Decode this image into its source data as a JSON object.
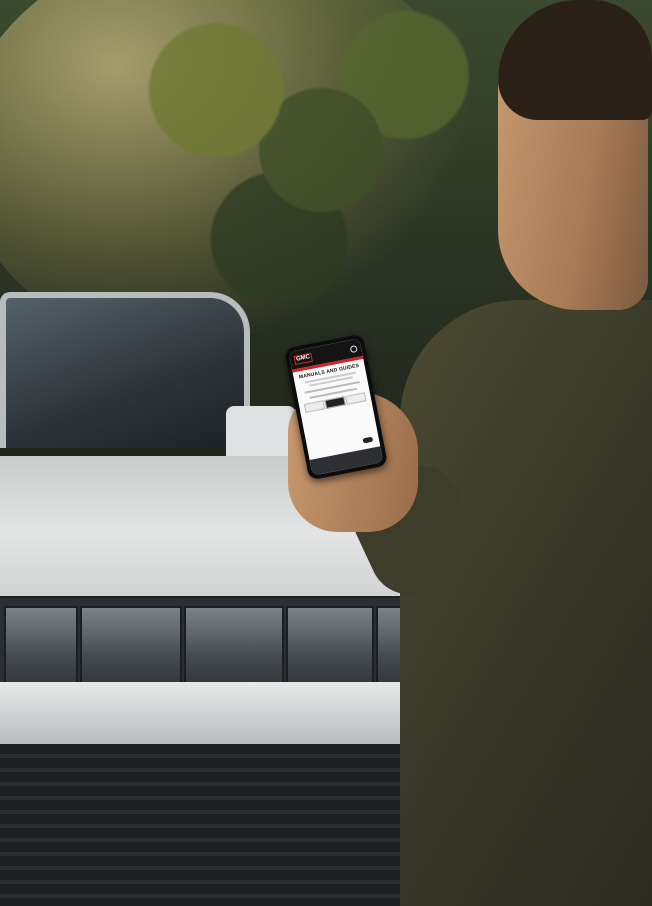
{
  "phone": {
    "logo": "GMC",
    "heading": "MANUALS AND GUIDES"
  }
}
